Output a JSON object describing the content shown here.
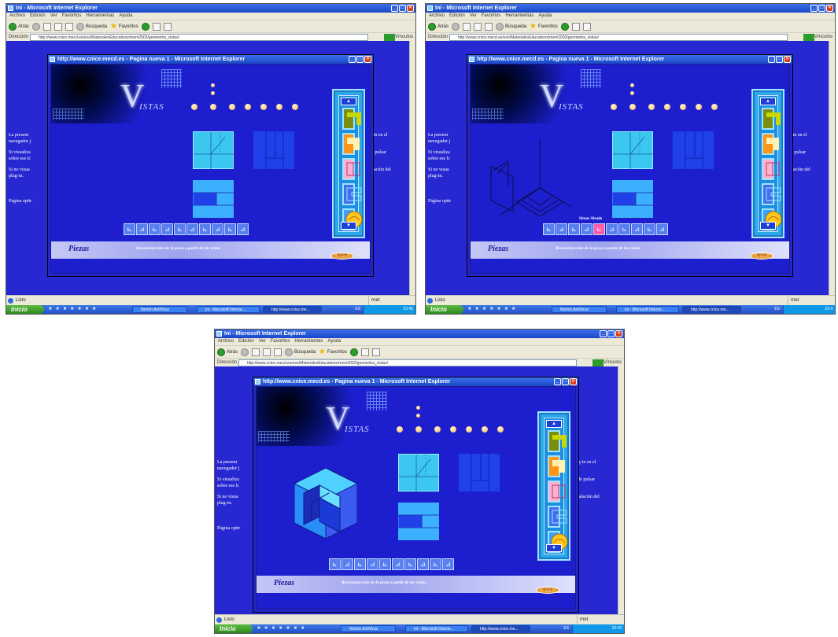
{
  "ie": {
    "window_title": "Ini - Microsoft Internet Explorer",
    "menu": [
      "Archivo",
      "Edición",
      "Ver",
      "Favoritos",
      "Herramientas",
      "Ayuda"
    ],
    "toolbar": {
      "back": "Atrás",
      "search": "Búsqueda",
      "favorites": "Favoritos"
    },
    "address_label": "Dirección",
    "url_short": "http://www.cnice.mecd.es/eos/MaterialesEducativos/mem2002/geometria_vistas/",
    "url_long": "http://www.cnice.mecd.es/eos/MaterialesEducativos/mem2002/geometria_vistas/",
    "go_label": "Ir",
    "links_label": "Vínculos",
    "status_text": "Listo",
    "zone_text": "rnet"
  },
  "page": {
    "left_lines": [
      "La present",
      "navegador j",
      "Si visualiza",
      "sobre ese lc",
      "Si no visua",
      "plug-in.",
      "Página optir"
    ],
    "right_lines": [
      "plug-in en el",
      "ue de pulsar",
      "instalación del"
    ]
  },
  "popup": {
    "title": "http://www.cnice.mecd.es - Pagina nueva 1 - Microsoft Internet Explorer",
    "logo_letter": "V",
    "logo_rest": "ISTAS",
    "section_title": "Piezas",
    "subtitle": "Reconstrucción de la pieza a partir de las vistas",
    "help_button": "Ayuda",
    "tooltip": "Situar Alzado",
    "colors": {
      "background": "#1d1fce",
      "front_view": "#3cc7f0",
      "side_view": "#2040ea",
      "panel": "#2aa8e8"
    }
  },
  "taskbar": {
    "start": "Inicio",
    "tasks": [
      "Norton AntiVirus",
      "ini - Microsoft Interne...",
      "http://www.cnice.me..."
    ],
    "lang": "ES",
    "clock_a": "23:45",
    "clock_b": "23:4",
    "clock_c": "23:49"
  },
  "icons": [
    "back-arrow-icon",
    "forward-arrow-icon",
    "stop-icon",
    "refresh-icon",
    "home-icon",
    "search-icon",
    "favorites-star-icon",
    "history-icon",
    "mail-icon",
    "print-icon",
    "edit-icon"
  ]
}
